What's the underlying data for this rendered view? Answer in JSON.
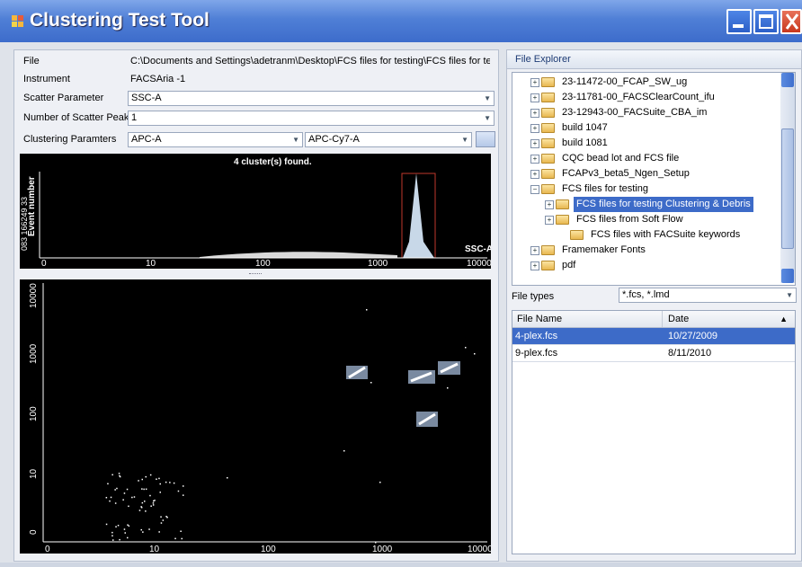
{
  "window": {
    "title": "Clustering Test Tool"
  },
  "form": {
    "file_label": "File",
    "file_value": "C:\\Documents and Settings\\adetranm\\Desktop\\FCS files for testing\\FCS files for testing C",
    "instrument_label": "Instrument",
    "instrument_value": "FACSAria -1",
    "scatter_param_label": "Scatter Parameter",
    "scatter_param_value": "SSC-A",
    "num_peaks_label": "Number of Scatter Peaks",
    "num_peaks_value": "1",
    "clustering_label": "Clustering Paramters",
    "clustering_param1": "APC-A",
    "clustering_param2": "APC-Cy7-A"
  },
  "histogram": {
    "title": "4 cluster(s) found.",
    "y_label": "Event number",
    "y_ticks": "083 166249 33",
    "x_param": "SSC-A",
    "x_ticks": [
      "0",
      "10",
      "100",
      "1000",
      "10000"
    ]
  },
  "scatter": {
    "x_ticks": [
      "0",
      "10",
      "100",
      "1000",
      "10000"
    ],
    "y_ticks": [
      "0",
      "10",
      "100",
      "1000",
      "10000"
    ]
  },
  "explorer": {
    "header": "File Explorer",
    "tree": [
      {
        "label": "23-11472-00_FCAP_SW_ug"
      },
      {
        "label": "23-11781-00_FACSClearCount_ifu"
      },
      {
        "label": "23-12943-00_FACSuite_CBA_im"
      },
      {
        "label": "build 1047"
      },
      {
        "label": "build 1081"
      },
      {
        "label": "CQC bead lot and FCS file"
      },
      {
        "label": "FCAPv3_beta5_Ngen_Setup"
      },
      {
        "label": "FCS files for testing"
      },
      {
        "label": "FCS files for testing Clustering & Debris"
      },
      {
        "label": "FCS files from Soft Flow"
      },
      {
        "label": "FCS files with FACSuite keywords"
      },
      {
        "label": "Framemaker Fonts"
      },
      {
        "label": "pdf"
      }
    ],
    "file_types_label": "File types",
    "file_types_value": "*.fcs, *.lmd",
    "columns": {
      "name": "File Name",
      "date": "Date"
    },
    "files": [
      {
        "name": "4-plex.fcs",
        "date": "10/27/2009"
      },
      {
        "name": "9-plex.fcs",
        "date": "8/11/2010"
      }
    ]
  },
  "colors": {
    "titlebar": "#4f7fd6",
    "selection": "#3d6bc8",
    "plot_bg": "#000000",
    "cluster": "#c8d8e8"
  }
}
